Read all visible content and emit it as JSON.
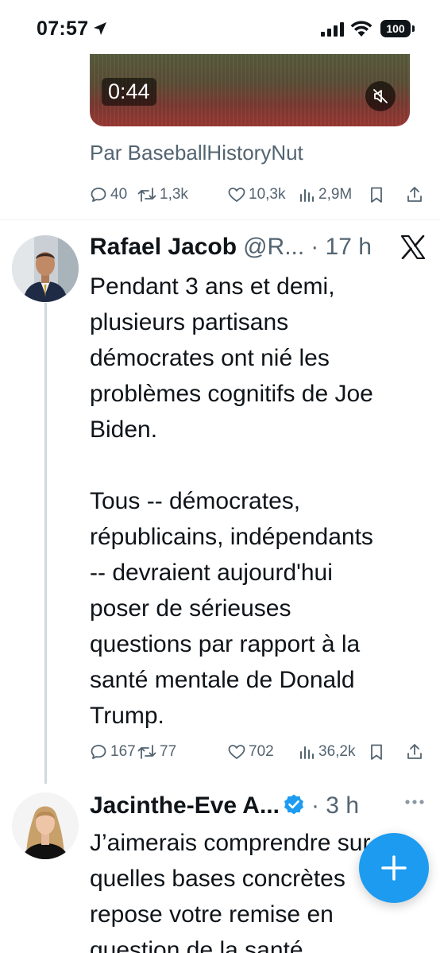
{
  "status_bar": {
    "time": "07:57",
    "battery": "100"
  },
  "previous_tweet": {
    "video_duration": "0:44",
    "attribution": "Par BaseballHistoryNut",
    "stats": {
      "replies": "40",
      "reposts": "1,3k",
      "likes": "10,3k",
      "views": "2,9M"
    }
  },
  "tweet": {
    "name": "Rafael Jacob",
    "handle": "@R...",
    "time": "· 17 h",
    "text": "Pendant 3 ans et demi,\nplusieurs partisans\ndémocrates ont nié les\nproblèmes cognitifs de Joe\nBiden.\n\nTous -- démocrates,\nrépublicains, indépendants\n-- devraient aujourd'hui\nposer de sérieuses\nquestions par rapport à la\nsanté mentale de Donald\nTrump.",
    "stats": {
      "replies": "167",
      "reposts": "77",
      "likes": "702",
      "views": "36,2k"
    }
  },
  "reply": {
    "name": "Jacinthe-Eve A...",
    "time": "· 3 h",
    "text": "J’aimerais comprendre sur\nquelles bases concrètes\nrepose votre remise en\nquestion de la santé"
  },
  "colors": {
    "accent": "#1d9bf0",
    "secondary_text": "#536471",
    "thread_line": "#cfd9de"
  },
  "icons": [
    "location-arrow-icon",
    "signal-icon",
    "wifi-icon",
    "mute-icon",
    "reply-icon",
    "repost-icon",
    "like-icon",
    "views-icon",
    "bookmark-icon",
    "share-icon",
    "x-logo-icon",
    "verified-icon",
    "more-icon",
    "plus-icon"
  ]
}
